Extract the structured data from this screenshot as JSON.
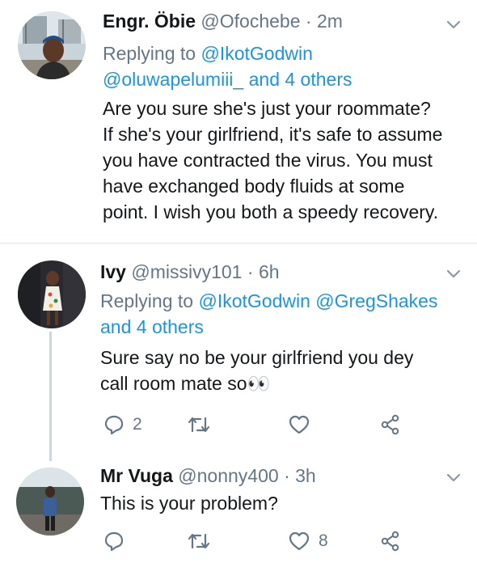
{
  "tweets": [
    {
      "name": "Engr. Öbie",
      "handle": "@Ofochebe",
      "sep": "·",
      "time": "2m",
      "replying_prefix": "Replying to",
      "replying_to_1": "@IkotGodwin",
      "replying_to_2": "@oluwapelumiii_",
      "replying_and": "and",
      "replying_others": "4 others",
      "body_lines": [
        "Are you sure she's just your roommate?",
        "If she's your girlfriend, it's safe to assume",
        "you have contracted the virus. You must",
        "have exchanged body fluids at some",
        "point. I wish you both a speedy recovery."
      ]
    },
    {
      "name": "Ivy",
      "handle": "@missivy101",
      "sep": "·",
      "time": "6h",
      "replying_prefix": "Replying to",
      "replying_to_1": "@IkotGodwin",
      "replying_to_2": "@GregShakes",
      "replying_and": "and",
      "replying_others": "4 others",
      "body_lines": [
        "Sure say no be your girlfriend you dey",
        "call room mate so👀"
      ],
      "actions": {
        "reply_count": "2",
        "retweet_count": "",
        "like_count": ""
      }
    },
    {
      "name": "Mr Vuga",
      "handle": "@nonny400",
      "sep": "·",
      "time": "3h",
      "body_lines": [
        "This is your problem?"
      ],
      "actions": {
        "reply_count": "",
        "retweet_count": "",
        "like_count": "8"
      }
    }
  ],
  "colors": {
    "link": "#1b95e0",
    "muted": "#657786",
    "text": "#14171a",
    "divider": "#e1e8ed"
  },
  "icons": [
    "chevron-down-icon",
    "reply-icon",
    "retweet-icon",
    "like-icon",
    "share-icon"
  ]
}
